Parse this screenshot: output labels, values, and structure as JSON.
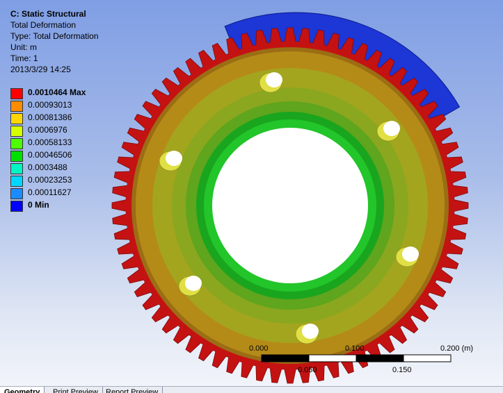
{
  "info": {
    "title": "C: Static Structural",
    "result": "Total Deformation",
    "type": "Type: Total Deformation",
    "unit": "Unit: m",
    "time": "Time: 1",
    "date": "2013/3/29 14:25"
  },
  "legend": {
    "max_label": "0.0010464 Max",
    "min_label": "0 Min",
    "entries": [
      {
        "label": "0.0010464 Max",
        "color": "#ff0000"
      },
      {
        "label": "0.00093013",
        "color": "#ff8c00"
      },
      {
        "label": "0.00081386",
        "color": "#ffd700"
      },
      {
        "label": "0.0006976",
        "color": "#d4ff00"
      },
      {
        "label": "0.00058133",
        "color": "#4dff00"
      },
      {
        "label": "0.00046506",
        "color": "#00e000"
      },
      {
        "label": "0.0003488",
        "color": "#00f5c4"
      },
      {
        "label": "0.00023253",
        "color": "#00d7ff"
      },
      {
        "label": "0.00011627",
        "color": "#1b8cff"
      },
      {
        "label": "0 Min",
        "color": "#0000ff"
      }
    ]
  },
  "colors": {
    "teeth": "#c41212",
    "rim_dark": "#9b6d14",
    "band_orange": "#b58b18",
    "band_olive": "#a3a51f",
    "band_yellowgreen": "#8aa71f",
    "band_green": "#5fa51d",
    "hub_green": "#1aa51e",
    "hub_bright": "#22c52a",
    "blue_part": "#1d36d6",
    "hole_light": "#ffffff",
    "hole_yellow": "#e0df44"
  },
  "scale_bar": {
    "labels_top": [
      "0.000",
      "0.100",
      "0.200 (m)"
    ],
    "labels_bottom": [
      "0.050",
      "0.150"
    ]
  },
  "tabs": [
    "Geometry",
    "Print Preview",
    "Report Preview"
  ]
}
